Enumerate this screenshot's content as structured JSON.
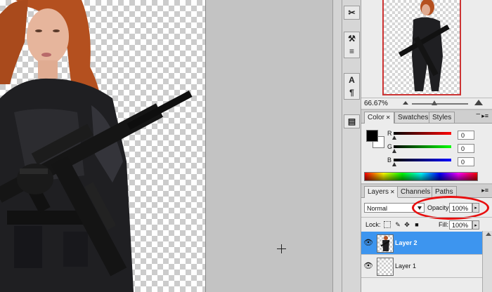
{
  "canvas": {
    "figure": "woman-with-rifle-cutout",
    "cursor": "crosshair-icon"
  },
  "tools": [
    {
      "name": "scissors-tool-icon",
      "glyph": "✂"
    },
    {
      "name": "brush-tool-icon",
      "glyph": "⚒"
    },
    {
      "name": "stamp-tool-icon",
      "glyph": "≡"
    },
    {
      "name": "type-tool-icon",
      "glyph": "A"
    },
    {
      "name": "paragraph-tool-icon",
      "glyph": "¶"
    },
    {
      "name": "notes-tool-icon",
      "glyph": "▤"
    }
  ],
  "navigator": {
    "zoom": "66.67%"
  },
  "color": {
    "tabs": {
      "color": "Color",
      "swatches": "Swatches",
      "styles": "Styles"
    },
    "foreground": "#000000",
    "background": "#ffffff",
    "channels": [
      {
        "label": "R",
        "value": "0",
        "color": "#c40000"
      },
      {
        "label": "G",
        "value": "0",
        "color": "#00a000"
      },
      {
        "label": "B",
        "value": "0",
        "color": "#0000c0"
      }
    ]
  },
  "layers": {
    "tabs": {
      "layers": "Layers",
      "channels": "Channels",
      "paths": "Paths"
    },
    "blend_mode": "Normal",
    "opacity_label": "Opacity:",
    "opacity": "100%",
    "lock_label": "Lock:",
    "fill_label": "Fill:",
    "fill": "100%",
    "items": [
      {
        "name": "Layer 2",
        "selected": true
      },
      {
        "name": "Layer 1",
        "selected": false
      }
    ]
  },
  "highlight_color": "#e81010",
  "selection_color": "#3d95ef"
}
